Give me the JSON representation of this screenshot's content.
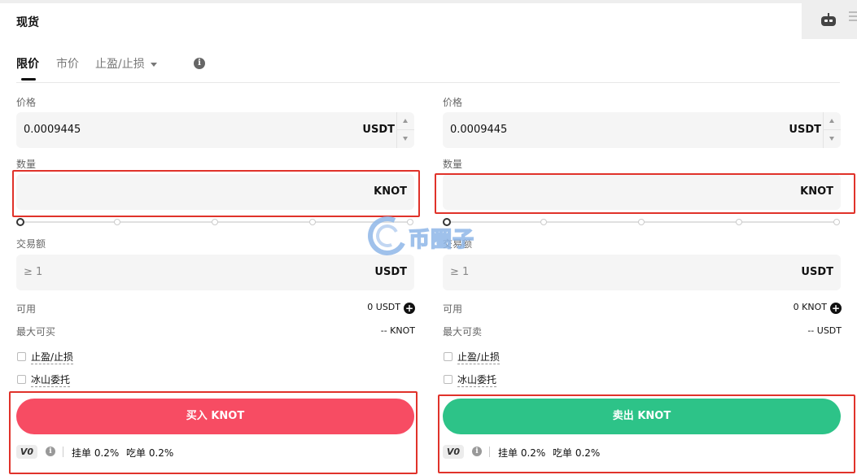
{
  "header": {
    "title": "现货"
  },
  "tabs": [
    {
      "label": "限价"
    },
    {
      "label": "市价"
    },
    {
      "label": "止盈/止损"
    }
  ],
  "watermark": "币圈子",
  "buy": {
    "price_label": "价格",
    "price_value": "0.0009445",
    "price_unit": "USDT",
    "amount_label": "数量",
    "amount_value": "",
    "amount_unit": "KNOT",
    "total_label": "交易额",
    "total_placeholder": "≥ 1",
    "total_unit": "USDT",
    "available_label": "可用",
    "available_value": "0 USDT",
    "max_label": "最大可买",
    "max_value": "-- KNOT",
    "tpsl_label": "止盈/止损",
    "iceberg_label": "冰山委托",
    "button_label": "买入 KNOT",
    "vip_level": "V0",
    "maker_fee": "挂单 0.2%",
    "taker_fee": "吃单 0.2%",
    "button_color": "#f74c63"
  },
  "sell": {
    "price_label": "价格",
    "price_value": "0.0009445",
    "price_unit": "USDT",
    "amount_label": "数量",
    "amount_value": "",
    "amount_unit": "KNOT",
    "total_label": "交易额",
    "total_placeholder": "≥ 1",
    "total_unit": "USDT",
    "available_label": "可用",
    "available_value": "0 KNOT",
    "max_label": "最大可卖",
    "max_value": "-- USDT",
    "tpsl_label": "止盈/止损",
    "iceberg_label": "冰山委托",
    "button_label": "卖出 KNOT",
    "vip_level": "V0",
    "maker_fee": "挂单 0.2%",
    "taker_fee": "吃单 0.2%",
    "button_color": "#2dc388"
  },
  "icons": {
    "info": "info-icon",
    "robot": "robot-icon",
    "plus": "plus-circle-icon",
    "caret": "caret-down-icon"
  }
}
